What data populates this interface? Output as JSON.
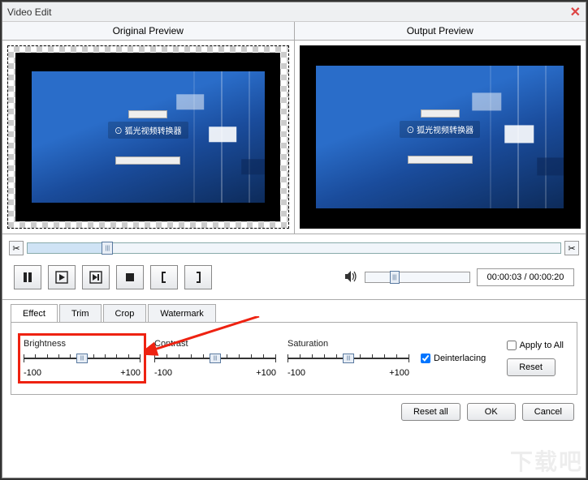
{
  "window": {
    "title": "Video Edit"
  },
  "previews": {
    "original_label": "Original Preview",
    "output_label": "Output Preview",
    "watermark_text": "⊙ 狐光视频转换器"
  },
  "playback": {
    "time_display": "00:00:03 / 00:00:20"
  },
  "tabs": {
    "effect": "Effect",
    "trim": "Trim",
    "crop": "Crop",
    "watermark": "Watermark",
    "active": "effect"
  },
  "effect": {
    "brightness": {
      "label": "Brightness",
      "min": "-100",
      "max": "+100"
    },
    "contrast": {
      "label": "Contrast",
      "min": "-100",
      "max": "+100"
    },
    "saturation": {
      "label": "Saturation",
      "min": "-100",
      "max": "+100"
    },
    "deinterlacing_label": "Deinterlacing",
    "apply_all_label": "Apply to All",
    "reset_label": "Reset"
  },
  "footer": {
    "reset_all": "Reset all",
    "ok": "OK",
    "cancel": "Cancel"
  },
  "bg_watermark": "下载吧"
}
